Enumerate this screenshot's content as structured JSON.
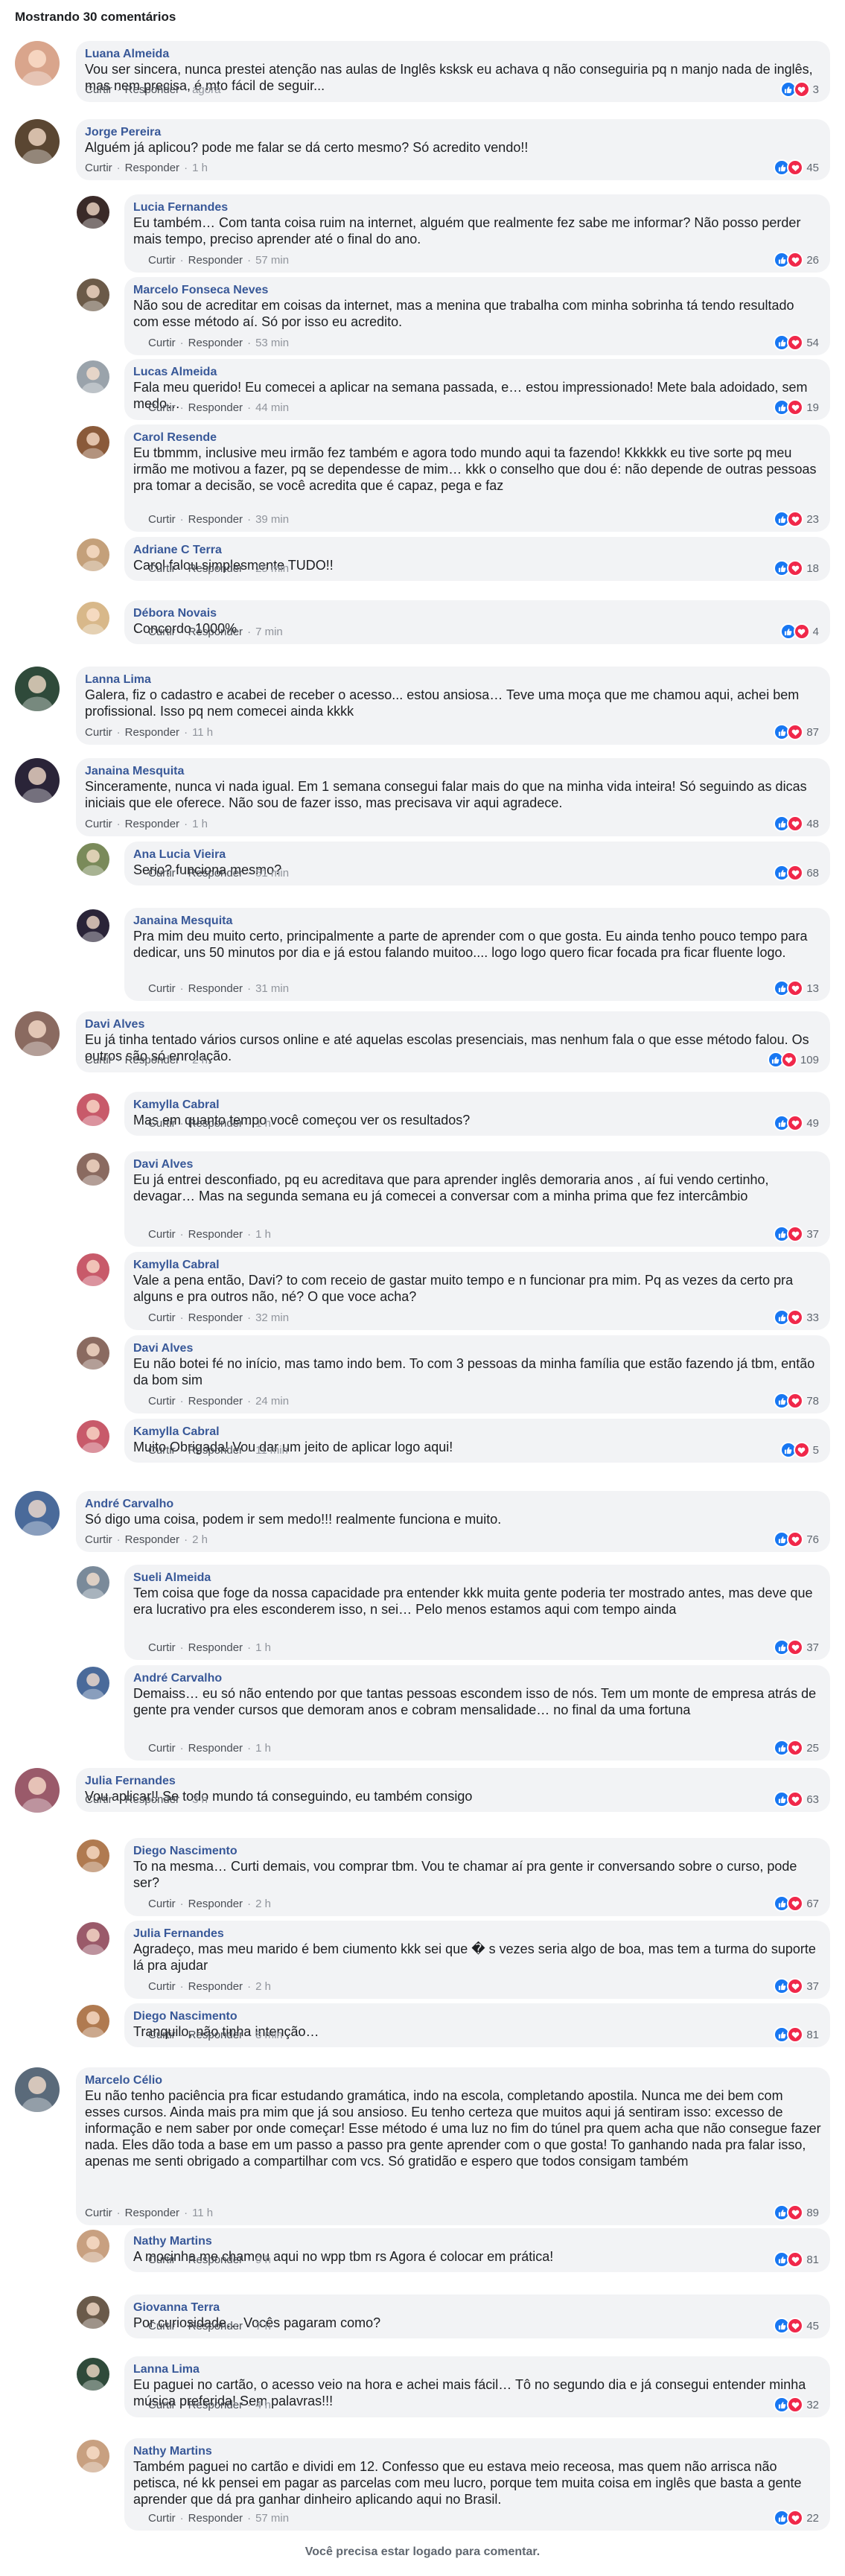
{
  "header": {
    "title": "Mostrando 30 comentários"
  },
  "labels": {
    "like": "Curtir",
    "reply": "Responder"
  },
  "footer": {
    "text": "Você precisa estar logado para comentar."
  },
  "colors": {
    "name": "#385898",
    "bubble": "#f2f3f5",
    "like": "#1877f2",
    "love": "#f0284a"
  },
  "comments": [
    {
      "name": "Luana Almeida",
      "text": "Vou ser sincera, nunca prestei atenção nas aulas de Inglês ksksk eu achava q não conseguiria pq n manjo nada de inglês, mas nem precisa, é mto fácil de seguir...",
      "time": "agora",
      "count": "3",
      "reply": false,
      "avatar": "#d9a58c"
    },
    {
      "name": "Jorge Pereira",
      "text": "Alguém já aplicou? pode me falar se dá certo mesmo? Só acredito vendo!!",
      "time": "1 h",
      "count": "45",
      "reply": false,
      "avatar": "#5a4632"
    },
    {
      "name": "Lucia Fernandes",
      "text": "Eu também… Com tanta coisa ruim na internet, alguém que realmente fez sabe me informar? Não posso perder mais tempo, preciso aprender até o final do ano.",
      "time": "57 min",
      "count": "26",
      "reply": true,
      "avatar": "#3a2a28"
    },
    {
      "name": "Marcelo Fonseca Neves",
      "text": "Não sou de acreditar em coisas da internet, mas a menina que trabalha com minha sobrinha tá tendo resultado com esse método aí. Só por isso eu acredito.",
      "time": "53 min",
      "count": "54",
      "reply": true,
      "avatar": "#6b5a48"
    },
    {
      "name": "Lucas Almeida",
      "text": "Fala meu querido! Eu comecei a aplicar na semana passada, e… estou impressionado! Mete bala adoidado, sem medo…",
      "time": "44 min",
      "count": "19",
      "reply": true,
      "avatar": "#9aa3ab"
    },
    {
      "name": "Carol Resende",
      "text": "Eu tbmmm, inclusive meu irmão fez também e agora todo mundo aqui ta fazendo! Kkkkkk eu tive sorte pq meu irmão me motivou a fazer, pq se dependesse de mim… kkk o conselho que dou é: não depende de outras pessoas pra tomar a decisão, se você acredita que é capaz, pega e faz",
      "time": "39 min",
      "count": "23",
      "reply": true,
      "avatar": "#8a5a3a"
    },
    {
      "name": "Adriane C Terra",
      "text": "Carol falou simplesmente TUDO!!",
      "time": "25 min",
      "count": "18",
      "reply": true,
      "avatar": "#c4a07a"
    },
    {
      "name": "Débora Novais",
      "text": "Concordo 1000%",
      "time": "7 min",
      "count": "4",
      "reply": true,
      "avatar": "#d8b88a"
    },
    {
      "name": "Lanna Lima",
      "text": "Galera, fiz o cadastro e acabei de receber o acesso... estou ansiosa… Teve uma moça que me chamou aqui, achei bem profissional. Isso pq nem comecei ainda kkkk",
      "time": "11 h",
      "count": "87",
      "reply": false,
      "avatar": "#2f4a3a"
    },
    {
      "name": "Janaina Mesquita",
      "text": "Sinceramente, nunca vi nada igual. Em 1 semana consegui falar mais do que na minha vida inteira! Só seguindo as dicas iniciais que ele oferece. Não sou de fazer isso, mas precisava vir aqui agradece.",
      "time": "1 h",
      "count": "48",
      "reply": false,
      "avatar": "#2a2438"
    },
    {
      "name": "Ana Lucia Vieira",
      "text": "Serio? funciona mesmo?",
      "time": "51 min",
      "count": "68",
      "reply": true,
      "avatar": "#7a8a5a"
    },
    {
      "name": "Janaina Mesquita",
      "text": "Pra mim deu muito certo, principalmente a parte de aprender com o que gosta. Eu ainda tenho pouco tempo para dedicar, uns 50 minutos por dia e já estou falando muitoo.... logo logo quero ficar focada pra ficar fluente logo.",
      "time": "31 min",
      "count": "13",
      "reply": true,
      "avatar": "#2a2438"
    },
    {
      "name": "Davi Alves",
      "text": "Eu já tinha tentado vários cursos online e até aquelas escolas presenciais, mas nenhum fala o que esse método falou. Os outros são só enrolação.",
      "time": "2 h",
      "count": "109",
      "reply": false,
      "avatar": "#8a6a60"
    },
    {
      "name": "Kamylla Cabral",
      "text": "Mas em quanto tempo você começou ver os resultados?",
      "time": "1 h",
      "count": "49",
      "reply": true,
      "avatar": "#c85a6a"
    },
    {
      "name": "Davi Alves",
      "text": "Eu já entrei desconfiado, pq eu acreditava que para aprender inglês demoraria anos , aí fui vendo certinho, devagar… Mas na segunda semana eu já comecei a conversar com a minha prima que fez intercâmbio",
      "time": "1 h",
      "count": "37",
      "reply": true,
      "avatar": "#8a6a60"
    },
    {
      "name": "Kamylla Cabral",
      "text": "Vale a pena então, Davi? to com receio de gastar muito tempo e n funcionar pra mim. Pq as vezes da certo pra alguns e pra outros não, né? O que voce acha?",
      "time": "32 min",
      "count": "33",
      "reply": true,
      "avatar": "#c85a6a"
    },
    {
      "name": "Davi Alves",
      "text": "Eu não botei fé no início, mas tamo indo bem. To com 3 pessoas da minha família que estão fazendo já tbm, então da bom sim",
      "time": "24 min",
      "count": "78",
      "reply": true,
      "avatar": "#8a6a60"
    },
    {
      "name": "Kamylla Cabral",
      "text": "Muito Obrigada! Vou dar um jeito de aplicar logo aqui!",
      "time": "11 min",
      "count": "5",
      "reply": true,
      "avatar": "#c85a6a"
    },
    {
      "name": "André Carvalho",
      "text": "Só digo uma coisa, podem ir sem medo!!! realmente funciona e muito.",
      "time": "2 h",
      "count": "76",
      "reply": false,
      "avatar": "#4a6a9a"
    },
    {
      "name": "Sueli Almeida",
      "text": "Tem coisa que foge da nossa capacidade pra entender kkk muita gente poderia ter mostrado antes, mas deve que era lucrativo pra eles esconderem isso, n sei… Pelo menos estamos aqui com tempo ainda",
      "time": "1 h",
      "count": "37",
      "reply": true,
      "avatar": "#7a8a9a"
    },
    {
      "name": "André Carvalho",
      "text": "Demaiss… eu só não entendo por que tantas pessoas escondem isso de nós. Tem um monte de empresa atrás de gente pra vender cursos que demoram anos e cobram mensalidade… no final da uma fortuna",
      "time": "1 h",
      "count": "25",
      "reply": true,
      "avatar": "#4a6a9a"
    },
    {
      "name": "Julia Fernandes",
      "text": "Vou aplicar!! Se todo mundo tá conseguindo, eu também consigo",
      "time": "3 h",
      "count": "63",
      "reply": false,
      "avatar": "#9a5a6a"
    },
    {
      "name": "Diego Nascimento",
      "text": "To na mesma… Curti demais, vou comprar tbm. Vou te chamar aí pra gente ir conversando sobre o curso, pode ser?",
      "time": "2 h",
      "count": "67",
      "reply": true,
      "avatar": "#b07a50"
    },
    {
      "name": "Julia Fernandes",
      "text": "Agradeço, mas meu marido é bem ciumento kkk sei que � s vezes seria algo de boa, mas tem a turma do suporte lá pra ajudar",
      "time": "2 h",
      "count": "37",
      "reply": true,
      "avatar": "#9a5a6a"
    },
    {
      "name": "Diego Nascimento",
      "text": "Tranquilo, não tinha intenção…",
      "time": "8 min",
      "count": "81",
      "reply": true,
      "avatar": "#b07a50"
    },
    {
      "name": "Marcelo Célio",
      "text": "Eu não tenho paciência pra ficar estudando gramática, indo na escola, completando apostila. Nunca me dei bem com esses cursos. Ainda mais pra mim que já sou ansioso. Eu tenho certeza que muitos aqui já sentiram isso: excesso de informação e nem saber por onde começar! Esse método é uma luz no fim do túnel pra quem acha que não consegue fazer nada. Eles dão toda a base em um passo a passo pra gente aprender com o que gosta! To ganhando nada pra falar isso, apenas me senti obrigado a compartilhar com vcs. Só gratidão e espero que todos consigam também",
      "time": "11 h",
      "count": "89",
      "reply": false,
      "avatar": "#5a6a7a"
    },
    {
      "name": "Nathy Martins",
      "text": "A mocinha me chamou aqui no wpp tbm rs Agora é colocar em prática!",
      "time": "9 h",
      "count": "81",
      "reply": true,
      "avatar": "#c8a080"
    },
    {
      "name": "Giovanna Terra",
      "text": "Por curiosidade… Vocês pagaram como?",
      "time": "7 h",
      "count": "45",
      "reply": true,
      "avatar": "#6a5a4a"
    },
    {
      "name": "Lanna Lima",
      "text": "Eu paguei no cartão, o acesso veio na hora e achei mais fácil… Tô no segundo dia e já consegui entender minha música preferida! Sem palavras!!!",
      "time": "4 h",
      "count": "32",
      "reply": true,
      "avatar": "#2f4a3a"
    },
    {
      "name": "Nathy Martins",
      "text": "Também paguei no cartão e dividi em 12. Confesso que eu estava meio receosa, mas quem não arrisca não petisca, né kk pensei em pagar as parcelas com meu lucro, porque tem muita coisa em inglês que basta a gente aprender que dá pra ganhar dinheiro aplicando aqui no Brasil.",
      "time": "57 min",
      "count": "22",
      "reply": true,
      "avatar": "#c8a080"
    }
  ]
}
